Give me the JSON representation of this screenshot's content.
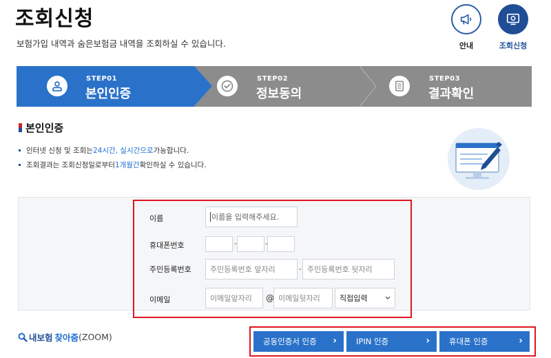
{
  "header": {
    "title": "조회신청",
    "subtitle": "보험가입 내역과 숨은보험금 내역을 조회하실 수 있습니다.",
    "icons": [
      {
        "label": "안내",
        "icon": "megaphone-icon"
      },
      {
        "label": "조회신청",
        "icon": "monitor-icon"
      }
    ]
  },
  "steps": [
    {
      "no": "STEP01",
      "name": "본인인증",
      "icon": "user-icon",
      "active": true
    },
    {
      "no": "STEP02",
      "name": "정보동의",
      "icon": "check-circle-icon",
      "active": false
    },
    {
      "no": "STEP03",
      "name": "결과확인",
      "icon": "document-icon",
      "active": false
    }
  ],
  "section": {
    "title": "본인인증",
    "bullet1": {
      "a": "인터넷 신청 및 조회는 ",
      "b": "24시간, 실시간으로",
      "c": " 가능합니다."
    },
    "bullet2": {
      "a": "조회결과는 조회신청일로부터 ",
      "b": "1개월간",
      "c": " 확인하실 수 있습니다."
    }
  },
  "form": {
    "name_label": "이름",
    "name_placeholder": "이름을 입력해주세요.",
    "phone_label": "휴대폰번호",
    "phone_sep": "-",
    "rrn_label": "주민등록번호",
    "rrn_front_placeholder": "주민등록번호 앞자리",
    "rrn_back_placeholder": "주민등록번호 뒷자리",
    "rrn_sep": "-",
    "email_label": "이메일",
    "email_front_placeholder": "이메일앞자리",
    "email_at": "@",
    "email_back_placeholder": "이메일뒷자리",
    "email_domain_selected": "직접입력"
  },
  "zoom": {
    "part1": "내보험",
    "part2": "찾아줌",
    "part3": "(ZOOM)"
  },
  "auth_buttons": [
    {
      "label": "공동인증서 인증"
    },
    {
      "label": "IPIN 인증"
    },
    {
      "label": "휴대폰 인증"
    }
  ],
  "colors": {
    "primary": "#2a72c9",
    "dark_blue": "#1f4e96",
    "step_gray": "#8c8c8c",
    "highlight_red": "#e0141e"
  }
}
